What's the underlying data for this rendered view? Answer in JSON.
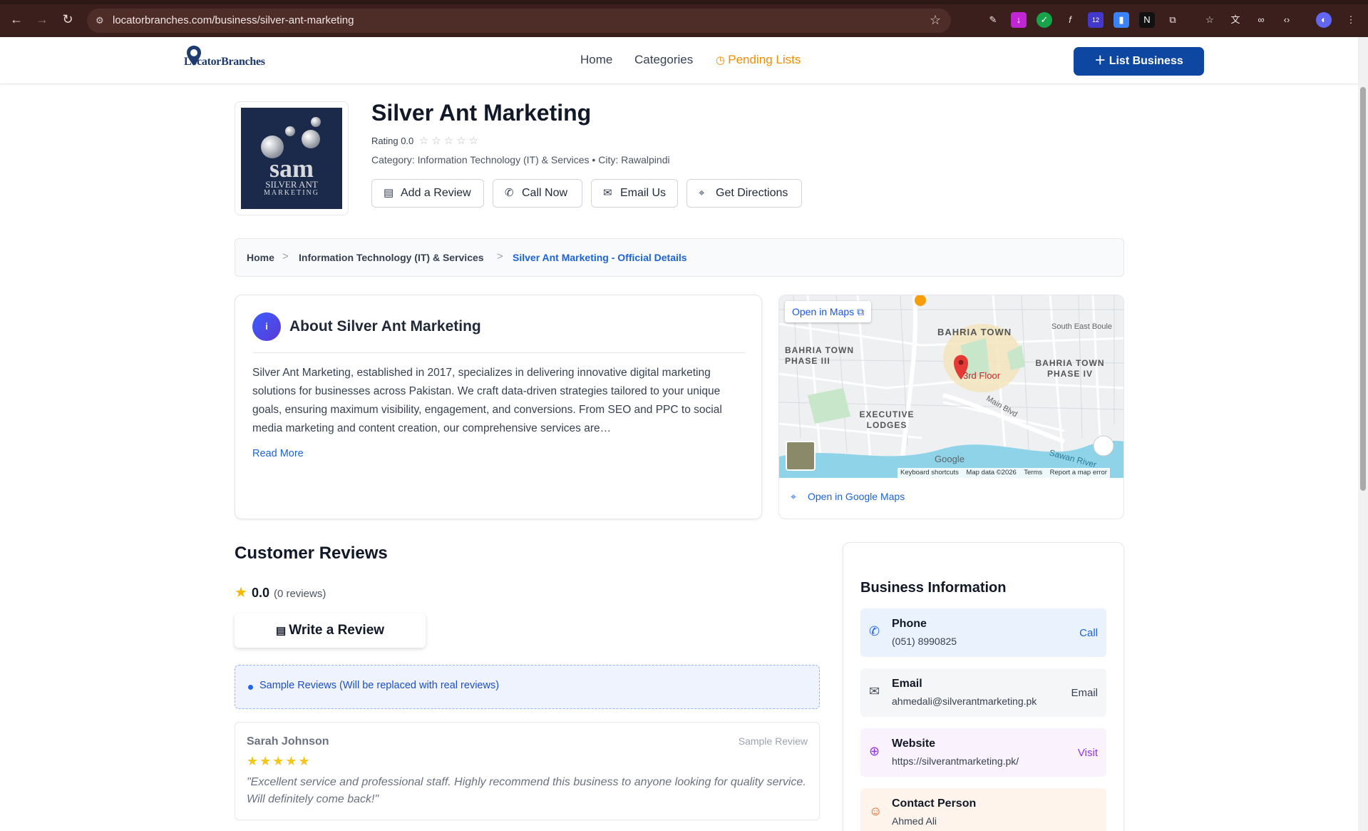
{
  "browser": {
    "url": "locatorbranches.com/business/silver-ant-marketing"
  },
  "header": {
    "logo_text": "LocatorBranches",
    "nav": [
      "Home",
      "Categories",
      "Pending Lists"
    ],
    "list_business": "List Business"
  },
  "business": {
    "name": "Silver Ant Marketing",
    "rating_label": "Rating 0.0",
    "category_line": "Category: Information Technology (IT) & Services • City: Rawalpindi",
    "logo_big": "sam",
    "logo_sub1": "SILVER ANT",
    "logo_sub2": "MARKETING",
    "actions": [
      "Add a Review",
      "Call Now",
      "Email Us",
      "Get Directions"
    ]
  },
  "breadcrumb": [
    "Home",
    "Information Technology (IT) & Services",
    "Silver Ant Marketing - Official Details"
  ],
  "about": {
    "icon_letter": "i",
    "title": "About Silver Ant Marketing",
    "text": "Silver Ant Marketing, established in 2017, specializes in delivering innovative digital marketing solutions for businesses across Pakistan. We craft data-driven strategies tailored to your unique goals, ensuring maximum visibility, engagement, and conversions. From SEO and PPC to social media marketing and content creation, our comprehensive services are…",
    "read_more": "Read More"
  },
  "map": {
    "open_in_maps": "Open in Maps",
    "labels": [
      "BAHRIA TOWN",
      "BAHRIA TOWN PHASE III",
      "BAHRIA TOWN PHASE IV",
      "EXECUTIVE LODGES",
      "3rd Floor",
      "Main Blvd",
      "Sawan River",
      "South East Boule",
      "Google"
    ],
    "attribution": [
      "Keyboard shortcuts",
      "Map data ©2026",
      "Terms",
      "Report a map error"
    ],
    "google_maps_link": "Open in Google Maps"
  },
  "reviews": {
    "title": "Customer Reviews",
    "average": "0.0",
    "count": "(0 reviews)",
    "write_button": "Write a Review",
    "sample_notice": "Sample Reviews (Will be replaced with real reviews)",
    "items": [
      {
        "name": "Sarah Johnson",
        "tag": "Sample Review",
        "stars": "★★★★★",
        "text": "\"Excellent service and professional staff. Highly recommend this business to anyone looking for quality service. Will definitely come back!\""
      }
    ]
  },
  "business_info": {
    "title": "Business Information",
    "rows": [
      {
        "label": "Phone",
        "value": "(051) 8990825",
        "action": "Call"
      },
      {
        "label": "Email",
        "value": "ahmedali@silverantmarketing.pk",
        "action": "Email"
      },
      {
        "label": "Website",
        "value": "https://silverantmarketing.pk/",
        "action": "Visit"
      },
      {
        "label": "Contact Person",
        "value": "Ahmed Ali",
        "action": ""
      }
    ]
  },
  "colors": {
    "brand_blue": "#0d47a1",
    "link_blue": "#1d63d8",
    "pending_orange": "#f28c00",
    "star_gold": "#f5c518"
  }
}
